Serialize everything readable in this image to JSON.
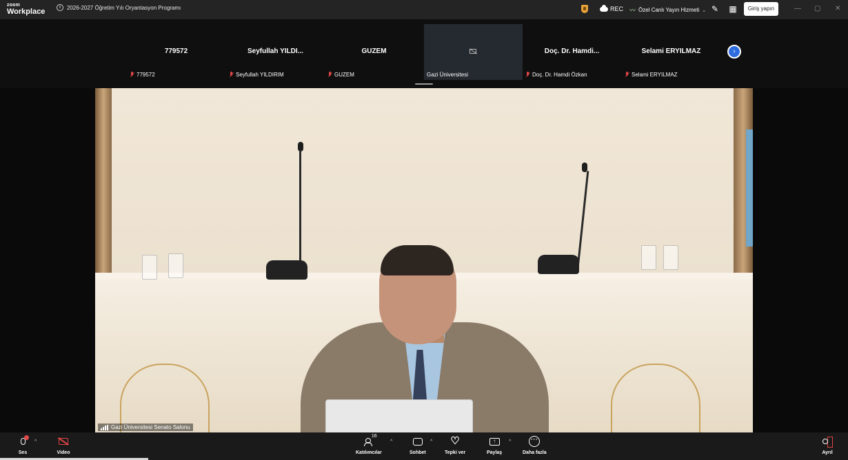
{
  "app": {
    "logo_small": "zoom",
    "logo_big": "Workplace"
  },
  "meeting": {
    "title": "2026-2027 Öğretim Yılı Oryantasyon Programı"
  },
  "titlebar": {
    "rec_label": "REC",
    "live_label": "Özel Canlı Yayın Hizmeti",
    "signin_label": "Giriş yapın"
  },
  "participants": [
    {
      "big_name": "779572",
      "small_name": "779572",
      "muted": true,
      "video": false
    },
    {
      "big_name": "Seyfullah  YILDI...",
      "small_name": "Seyfullah YILDIRIM",
      "muted": true,
      "video": false
    },
    {
      "big_name": "GUZEM",
      "small_name": "GUZEM",
      "muted": true,
      "video": false
    },
    {
      "big_name": "",
      "small_name": "Gazi Üniversitesi",
      "muted": false,
      "video": false,
      "active": true
    },
    {
      "big_name": "Doç.  Dr.  Hamdi...",
      "small_name": "Doç. Dr. Hamdi Özkan",
      "muted": true,
      "video": false
    },
    {
      "big_name": "Selami ERYILMAZ",
      "small_name": "Selami ERYILMAZ",
      "muted": true,
      "video": false
    }
  ],
  "main_video": {
    "label": "Gazi Üniversitesi Senato Salonu"
  },
  "toolbar": {
    "audio_label": "Ses",
    "video_label": "Video",
    "participants_label": "Katılımcılar",
    "participants_count": "16",
    "chat_label": "Sohbet",
    "reactions_label": "Tepki ver",
    "share_label": "Paylaş",
    "more_label": "Daha fazla",
    "leave_label": "Ayrıl"
  },
  "colors": {
    "accent_blue": "#2d6cdf",
    "muted_red": "#e04545",
    "toolbar_bg": "#1a1a1a",
    "titlebar_bg": "#242424"
  }
}
